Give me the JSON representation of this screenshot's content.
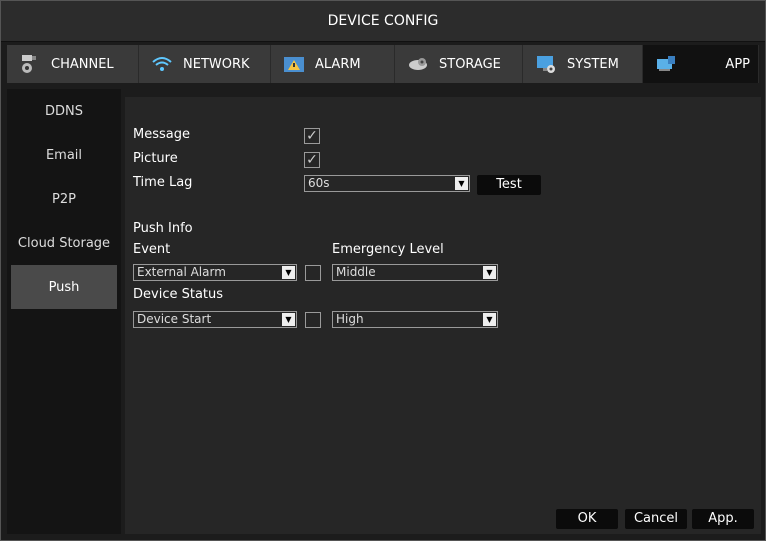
{
  "window": {
    "title": "DEVICE CONFIG"
  },
  "tabs": [
    {
      "label": "CHANNEL",
      "icon": "camera-icon"
    },
    {
      "label": "NETWORK",
      "icon": "wifi-icon"
    },
    {
      "label": "ALARM",
      "icon": "alarm-icon"
    },
    {
      "label": "STORAGE",
      "icon": "storage-icon"
    },
    {
      "label": "SYSTEM",
      "icon": "system-icon"
    },
    {
      "label": "APP",
      "icon": "app-icon",
      "active": true
    }
  ],
  "sidebar": {
    "items": [
      {
        "label": "DDNS"
      },
      {
        "label": "Email"
      },
      {
        "label": "P2P"
      },
      {
        "label": "Cloud Storage"
      },
      {
        "label": "Push",
        "active": true
      }
    ]
  },
  "form": {
    "message_label": "Message",
    "message_checked": true,
    "picture_label": "Picture",
    "picture_checked": true,
    "time_lag_label": "Time Lag",
    "time_lag_value": "60s",
    "test_button": "Test",
    "push_info_label": "Push Info",
    "event_label": "Event",
    "emergency_level_label": "Emergency Level",
    "event_value": "External Alarm",
    "event_checked": false,
    "event_level_value": "Middle",
    "device_status_label": "Device Status",
    "device_status_value": "Device Start",
    "device_status_checked": false,
    "device_level_value": "High"
  },
  "footer": {
    "ok_label": "OK",
    "cancel_label": "Cancel",
    "apply_label": "App."
  },
  "colors": {
    "background": "#1c1c1c",
    "panel": "#262626",
    "tabbar": "#3a3a3a",
    "active_tab": "#111111",
    "active_sidebar": "#4a4a4a"
  }
}
